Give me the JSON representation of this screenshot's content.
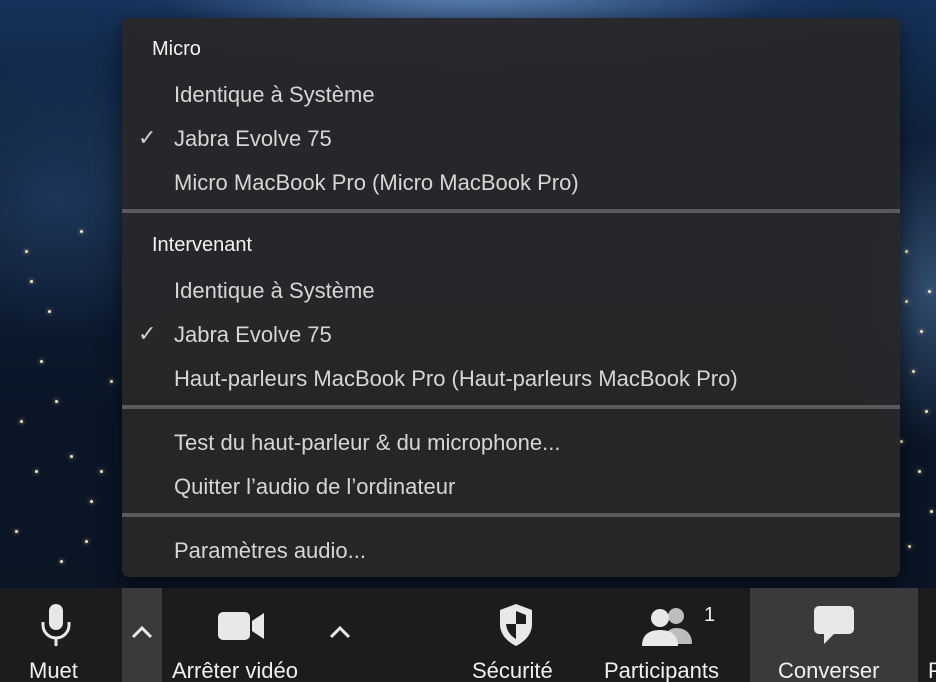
{
  "menu": {
    "micro_header": "Micro",
    "micro_items": [
      {
        "label": "Identique à Système",
        "checked": false
      },
      {
        "label": "Jabra Evolve 75",
        "checked": true
      },
      {
        "label": "Micro MacBook Pro (Micro MacBook Pro)",
        "checked": false
      }
    ],
    "speaker_header": "Intervenant",
    "speaker_items": [
      {
        "label": "Identique à Système",
        "checked": false
      },
      {
        "label": "Jabra Evolve 75",
        "checked": true
      },
      {
        "label": "Haut-parleurs MacBook Pro (Haut-parleurs MacBook Pro)",
        "checked": false
      }
    ],
    "test_label": "Test du haut-parleur & du microphone...",
    "leave_label": "Quitter l’audio de l’ordinateur",
    "settings_label": "Paramètres audio...",
    "check_glyph": "✓"
  },
  "toolbar": {
    "mute_label": "Muet",
    "video_label": "Arrêter vidéo",
    "security_label": "Sécurité",
    "participants_label": "Participants",
    "participants_count": "1",
    "chat_label": "Converser",
    "overflow_label": "P"
  },
  "colors": {
    "menu_bg": "#28282a",
    "toolbar_bg": "#1c1c1e",
    "active_button_bg": "#3a3a3c",
    "separator": "#5a5a5c"
  }
}
